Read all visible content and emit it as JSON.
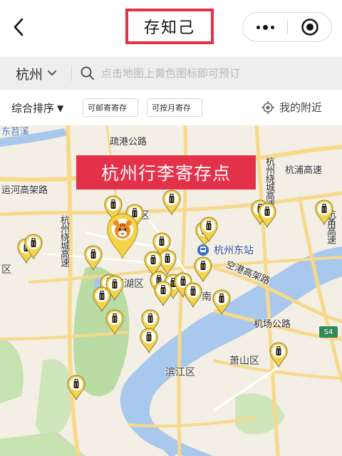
{
  "header": {
    "title": "存知己",
    "back_icon": "chevron-left-icon",
    "more_icon": "more-dots-icon",
    "close_icon": "target-close-icon"
  },
  "search": {
    "city": "杭州",
    "placeholder": "点击地图上黄色图标即可预订"
  },
  "filters": {
    "sort_label": "综合排序",
    "sort_arrow": "▼",
    "chips": [
      "可邮寄寄存",
      "可按月寄存"
    ],
    "nearby_label": "我的附近"
  },
  "map": {
    "banner": "杭州行李寄存点",
    "labels": {
      "shuguang": "疏港公路",
      "yunhe": "运河高架路",
      "hangzhou_rao": "杭州绕城高速",
      "hangpu": "杭浦高速",
      "hangyong": "杭甬高速",
      "hangzhou_east": "杭州东站",
      "konggang": "空港高架路",
      "jichang": "机场公路",
      "binjiang": "滨江区",
      "xiaoshan": "萧山区",
      "xihu": "西湖区",
      "gongshu": "区",
      "dongshou": "东苕溪",
      "ring_right": "杭州绕城高速",
      "shangcheng": "南",
      "keqiao": "区",
      "yuhang_v": "杭州绕城高速",
      "s4": "S4"
    },
    "pin_icon": "luggage-pin-icon",
    "tiger_icon": "tiger-marker-icon",
    "station_icon": "train-station-icon",
    "colors": {
      "pin": "#f5d44b",
      "pin_outline": "#8a7a3a",
      "water": "#a9c8ee",
      "park": "#b9dca4",
      "road": "#f7d98a",
      "banner": "#e3314a"
    }
  }
}
